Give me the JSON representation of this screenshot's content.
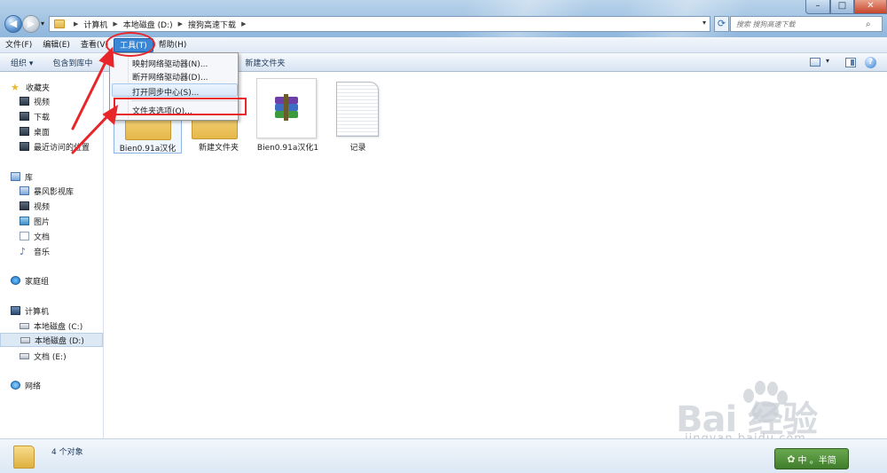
{
  "address": {
    "crumbs": [
      "计算机",
      "本地磁盘 (D:)",
      "搜狗高速下载"
    ],
    "search_placeholder": "搜索 搜狗高速下载"
  },
  "menubar": {
    "items": [
      "文件(F)",
      "编辑(E)",
      "查看(V)",
      "工具(T)",
      "帮助(H)"
    ],
    "active_index": 3
  },
  "toolbar": {
    "organize": "组织 ▾",
    "include_in_library": "包含到库中",
    "new_folder": "新建文件夹"
  },
  "tools_menu": {
    "items": [
      "映射网络驱动器(N)...",
      "断开网络驱动器(D)...",
      "打开同步中心(S)...",
      "文件夹选项(O)..."
    ],
    "hover_index": 2,
    "highlight_index": 3
  },
  "sidebar": {
    "favorites": {
      "label": "收藏夹",
      "items": [
        "视频",
        "下载",
        "桌面",
        "最近访问的位置"
      ]
    },
    "libraries": {
      "label": "库",
      "items": [
        "暴风影视库",
        "视频",
        "图片",
        "文档",
        "音乐"
      ]
    },
    "homegroup": "家庭组",
    "computer": {
      "label": "计算机",
      "items": [
        "本地磁盘 (C:)",
        "本地磁盘 (D:)",
        "文档 (E:)"
      ],
      "selected_index": 1
    },
    "network": "网络"
  },
  "files": [
    {
      "name": "Bien0.91a汉化",
      "type": "folder"
    },
    {
      "name": "新建文件夹",
      "type": "folder"
    },
    {
      "name": "Bien0.91a汉化1",
      "type": "archive"
    },
    {
      "name": "记录",
      "type": "text"
    }
  ],
  "status": {
    "text": "4 个对象"
  },
  "watermark": {
    "brand": "Bai  经验",
    "url": "jingyan.baidu.com"
  },
  "ime": {
    "label": "中 。半简"
  },
  "colors": {
    "accent": "#3a87d6",
    "annotation": "#e8262a",
    "titlebar": "#a6c6e4"
  }
}
